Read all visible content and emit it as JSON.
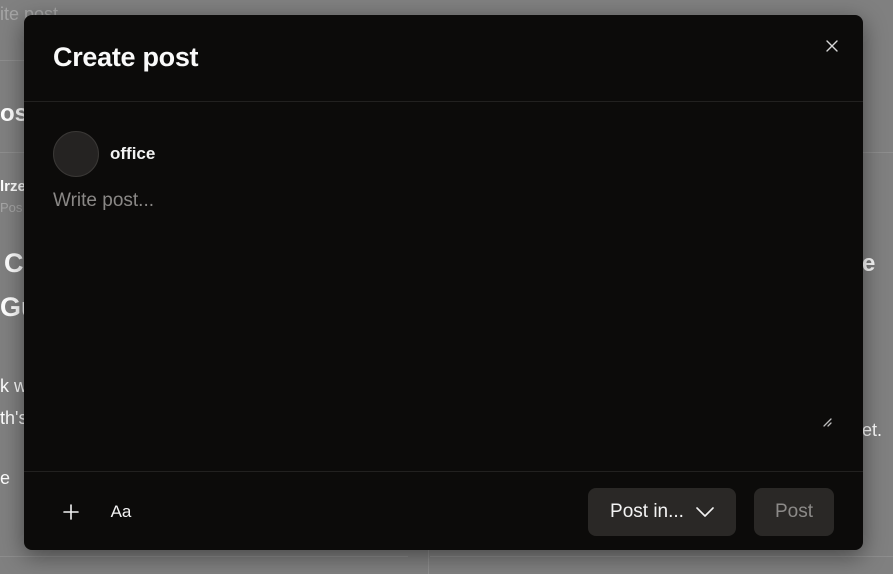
{
  "background": {
    "top_fragment": "ite post",
    "heading_fragment": "ost",
    "author_fragment": "lrze",
    "meta_fragment": "Pos",
    "title_fragment_1": "C",
    "title_fragment_2": "Gu",
    "body_fragment_1": "k w",
    "body_fragment_2": "th's",
    "body_fragment_3": "e",
    "right_title_fragment": "e",
    "right_body_fragment": "et."
  },
  "modal": {
    "title": "Create post",
    "close_icon": "close-icon",
    "author": {
      "name": "office"
    },
    "post": {
      "placeholder": "Write post...",
      "value": ""
    },
    "toolbar": {
      "add_icon": "plus-icon",
      "format_label": "Aa"
    },
    "post_in": {
      "label": "Post in...",
      "icon": "chevron-down-icon"
    },
    "post_button": {
      "label": "Post"
    }
  },
  "colors": {
    "overlay": "#808080",
    "modal_bg": "#0c0b0a",
    "button_bg": "#2a2826",
    "disabled_text": "#8c8a88"
  }
}
